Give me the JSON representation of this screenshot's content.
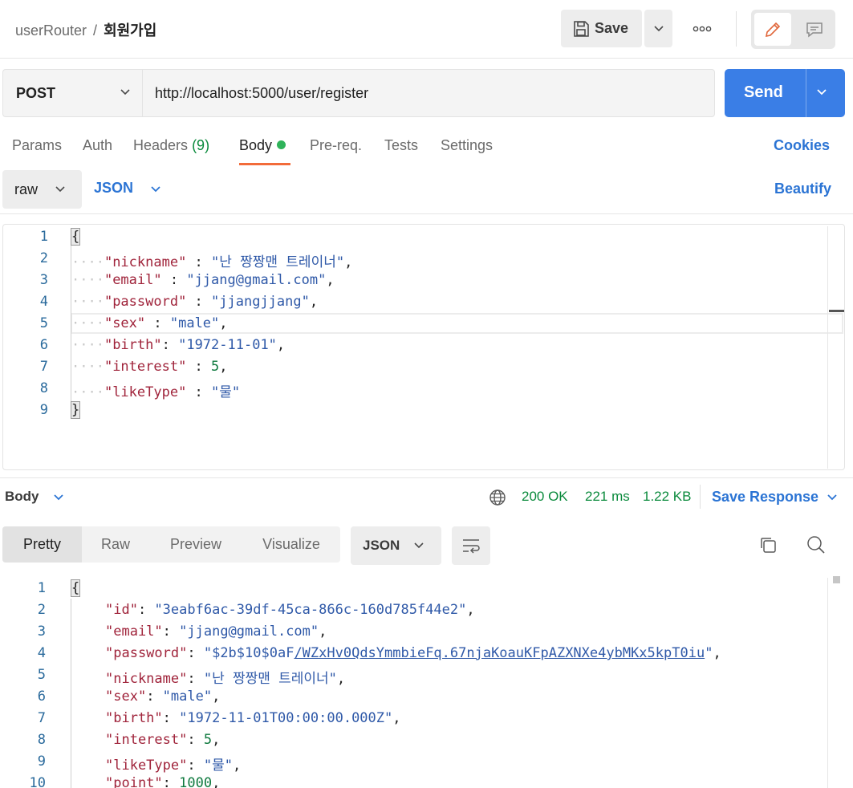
{
  "breadcrumb": {
    "parent": "userRouter",
    "separator": "/",
    "current": "회원가입"
  },
  "header": {
    "save_label": "Save"
  },
  "request": {
    "method": "POST",
    "url": "http://localhost:5000/user/register",
    "send_label": "Send"
  },
  "tabs": {
    "params": "Params",
    "auth": "Auth",
    "headers": "Headers",
    "headers_count": "(9)",
    "body": "Body",
    "prereq": "Pre-req.",
    "tests": "Tests",
    "settings": "Settings",
    "cookies": "Cookies"
  },
  "body_options": {
    "mode": "raw",
    "language": "JSON",
    "beautify": "Beautify"
  },
  "request_body": {
    "line_numbers": [
      "1",
      "2",
      "3",
      "4",
      "5",
      "6",
      "7",
      "8",
      "9"
    ],
    "open": "{",
    "close": "}",
    "fields": [
      {
        "key": "\"nickname\"",
        "sep": " : ",
        "value": "\"난 짱짱맨 트레이너\"",
        "end": ","
      },
      {
        "key": "\"email\"",
        "sep": " : ",
        "value": "\"jjang@gmail.com\"",
        "end": ","
      },
      {
        "key": "\"password\"",
        "sep": " : ",
        "value": "\"jjangjjang\"",
        "end": ","
      },
      {
        "key": "\"sex\"",
        "sep": " : ",
        "value": "\"male\"",
        "end": ","
      },
      {
        "key": "\"birth\"",
        "sep": ": ",
        "value": "\"1972-11-01\"",
        "end": ","
      },
      {
        "key": "\"interest\"",
        "sep": " : ",
        "value": "5",
        "end": ","
      },
      {
        "key": "\"likeType\"",
        "sep": " : ",
        "value": "\"물\"",
        "end": ""
      }
    ]
  },
  "response": {
    "body_label": "Body",
    "status": "200 OK",
    "time": "221 ms",
    "size": "1.22 KB",
    "save_response": "Save Response",
    "view_tabs": {
      "pretty": "Pretty",
      "raw": "Raw",
      "preview": "Preview",
      "visualize": "Visualize"
    },
    "format": "JSON",
    "line_numbers": [
      "1",
      "2",
      "3",
      "4",
      "5",
      "6",
      "7",
      "8",
      "9",
      "10"
    ],
    "open": "{",
    "fields": [
      {
        "key": "\"id\"",
        "value": "\"3eabf6ac-39df-45ca-866c-160d785f44e2\"",
        "end": ","
      },
      {
        "key": "\"email\"",
        "value": "\"jjang@gmail.com\"",
        "end": ","
      },
      {
        "key": "\"password\"",
        "value_pre": "\"$2b$10$0aF",
        "value_link": "/WZxHv0QdsYmmbieFq.67njaKoauKFpAZXNXe4ybMKx5kpT0iu",
        "value_post": "\"",
        "end": ","
      },
      {
        "key": "\"nickname\"",
        "value": "\"난 짱짱맨 트레이너\"",
        "end": ","
      },
      {
        "key": "\"sex\"",
        "value": "\"male\"",
        "end": ","
      },
      {
        "key": "\"birth\"",
        "value": "\"1972-11-01T00:00:00.000Z\"",
        "end": ","
      },
      {
        "key": "\"interest\"",
        "value": "5",
        "end": ","
      },
      {
        "key": "\"likeType\"",
        "value": "\"물\"",
        "end": ","
      },
      {
        "key": "\"point\"",
        "value": "1000",
        "end": ","
      }
    ]
  },
  "colors": {
    "accent": "#3a7ee6",
    "link": "#2b74d4",
    "status_ok": "#0a8a3c",
    "active_tab": "#f26b3a"
  }
}
